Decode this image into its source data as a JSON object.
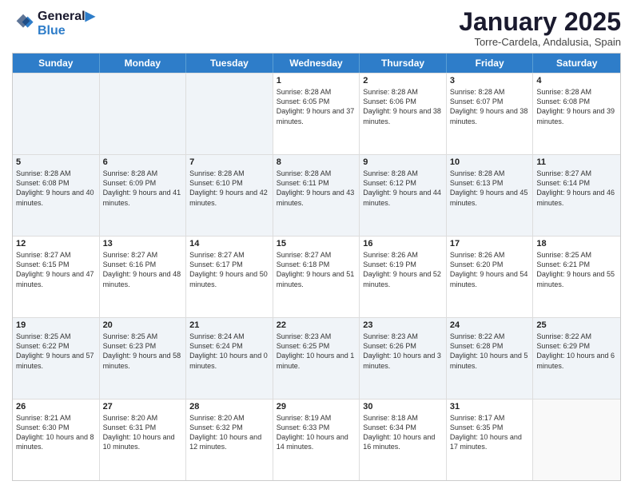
{
  "header": {
    "logo_line1": "General",
    "logo_line2": "Blue",
    "month_title": "January 2025",
    "location": "Torre-Cardela, Andalusia, Spain"
  },
  "calendar": {
    "days_of_week": [
      "Sunday",
      "Monday",
      "Tuesday",
      "Wednesday",
      "Thursday",
      "Friday",
      "Saturday"
    ],
    "rows": [
      [
        {
          "day": "",
          "info": "",
          "shaded": true
        },
        {
          "day": "",
          "info": "",
          "shaded": true
        },
        {
          "day": "",
          "info": "",
          "shaded": true
        },
        {
          "day": "1",
          "info": "Sunrise: 8:28 AM\nSunset: 6:05 PM\nDaylight: 9 hours and 37 minutes.",
          "shaded": false
        },
        {
          "day": "2",
          "info": "Sunrise: 8:28 AM\nSunset: 6:06 PM\nDaylight: 9 hours and 38 minutes.",
          "shaded": false
        },
        {
          "day": "3",
          "info": "Sunrise: 8:28 AM\nSunset: 6:07 PM\nDaylight: 9 hours and 38 minutes.",
          "shaded": false
        },
        {
          "day": "4",
          "info": "Sunrise: 8:28 AM\nSunset: 6:08 PM\nDaylight: 9 hours and 39 minutes.",
          "shaded": false
        }
      ],
      [
        {
          "day": "5",
          "info": "Sunrise: 8:28 AM\nSunset: 6:08 PM\nDaylight: 9 hours and 40 minutes.",
          "shaded": true
        },
        {
          "day": "6",
          "info": "Sunrise: 8:28 AM\nSunset: 6:09 PM\nDaylight: 9 hours and 41 minutes.",
          "shaded": true
        },
        {
          "day": "7",
          "info": "Sunrise: 8:28 AM\nSunset: 6:10 PM\nDaylight: 9 hours and 42 minutes.",
          "shaded": true
        },
        {
          "day": "8",
          "info": "Sunrise: 8:28 AM\nSunset: 6:11 PM\nDaylight: 9 hours and 43 minutes.",
          "shaded": true
        },
        {
          "day": "9",
          "info": "Sunrise: 8:28 AM\nSunset: 6:12 PM\nDaylight: 9 hours and 44 minutes.",
          "shaded": true
        },
        {
          "day": "10",
          "info": "Sunrise: 8:28 AM\nSunset: 6:13 PM\nDaylight: 9 hours and 45 minutes.",
          "shaded": true
        },
        {
          "day": "11",
          "info": "Sunrise: 8:27 AM\nSunset: 6:14 PM\nDaylight: 9 hours and 46 minutes.",
          "shaded": true
        }
      ],
      [
        {
          "day": "12",
          "info": "Sunrise: 8:27 AM\nSunset: 6:15 PM\nDaylight: 9 hours and 47 minutes.",
          "shaded": false
        },
        {
          "day": "13",
          "info": "Sunrise: 8:27 AM\nSunset: 6:16 PM\nDaylight: 9 hours and 48 minutes.",
          "shaded": false
        },
        {
          "day": "14",
          "info": "Sunrise: 8:27 AM\nSunset: 6:17 PM\nDaylight: 9 hours and 50 minutes.",
          "shaded": false
        },
        {
          "day": "15",
          "info": "Sunrise: 8:27 AM\nSunset: 6:18 PM\nDaylight: 9 hours and 51 minutes.",
          "shaded": false
        },
        {
          "day": "16",
          "info": "Sunrise: 8:26 AM\nSunset: 6:19 PM\nDaylight: 9 hours and 52 minutes.",
          "shaded": false
        },
        {
          "day": "17",
          "info": "Sunrise: 8:26 AM\nSunset: 6:20 PM\nDaylight: 9 hours and 54 minutes.",
          "shaded": false
        },
        {
          "day": "18",
          "info": "Sunrise: 8:25 AM\nSunset: 6:21 PM\nDaylight: 9 hours and 55 minutes.",
          "shaded": false
        }
      ],
      [
        {
          "day": "19",
          "info": "Sunrise: 8:25 AM\nSunset: 6:22 PM\nDaylight: 9 hours and 57 minutes.",
          "shaded": true
        },
        {
          "day": "20",
          "info": "Sunrise: 8:25 AM\nSunset: 6:23 PM\nDaylight: 9 hours and 58 minutes.",
          "shaded": true
        },
        {
          "day": "21",
          "info": "Sunrise: 8:24 AM\nSunset: 6:24 PM\nDaylight: 10 hours and 0 minutes.",
          "shaded": true
        },
        {
          "day": "22",
          "info": "Sunrise: 8:23 AM\nSunset: 6:25 PM\nDaylight: 10 hours and 1 minute.",
          "shaded": true
        },
        {
          "day": "23",
          "info": "Sunrise: 8:23 AM\nSunset: 6:26 PM\nDaylight: 10 hours and 3 minutes.",
          "shaded": true
        },
        {
          "day": "24",
          "info": "Sunrise: 8:22 AM\nSunset: 6:28 PM\nDaylight: 10 hours and 5 minutes.",
          "shaded": true
        },
        {
          "day": "25",
          "info": "Sunrise: 8:22 AM\nSunset: 6:29 PM\nDaylight: 10 hours and 6 minutes.",
          "shaded": true
        }
      ],
      [
        {
          "day": "26",
          "info": "Sunrise: 8:21 AM\nSunset: 6:30 PM\nDaylight: 10 hours and 8 minutes.",
          "shaded": false
        },
        {
          "day": "27",
          "info": "Sunrise: 8:20 AM\nSunset: 6:31 PM\nDaylight: 10 hours and 10 minutes.",
          "shaded": false
        },
        {
          "day": "28",
          "info": "Sunrise: 8:20 AM\nSunset: 6:32 PM\nDaylight: 10 hours and 12 minutes.",
          "shaded": false
        },
        {
          "day": "29",
          "info": "Sunrise: 8:19 AM\nSunset: 6:33 PM\nDaylight: 10 hours and 14 minutes.",
          "shaded": false
        },
        {
          "day": "30",
          "info": "Sunrise: 8:18 AM\nSunset: 6:34 PM\nDaylight: 10 hours and 16 minutes.",
          "shaded": false
        },
        {
          "day": "31",
          "info": "Sunrise: 8:17 AM\nSunset: 6:35 PM\nDaylight: 10 hours and 17 minutes.",
          "shaded": false
        },
        {
          "day": "",
          "info": "",
          "shaded": false
        }
      ]
    ]
  }
}
